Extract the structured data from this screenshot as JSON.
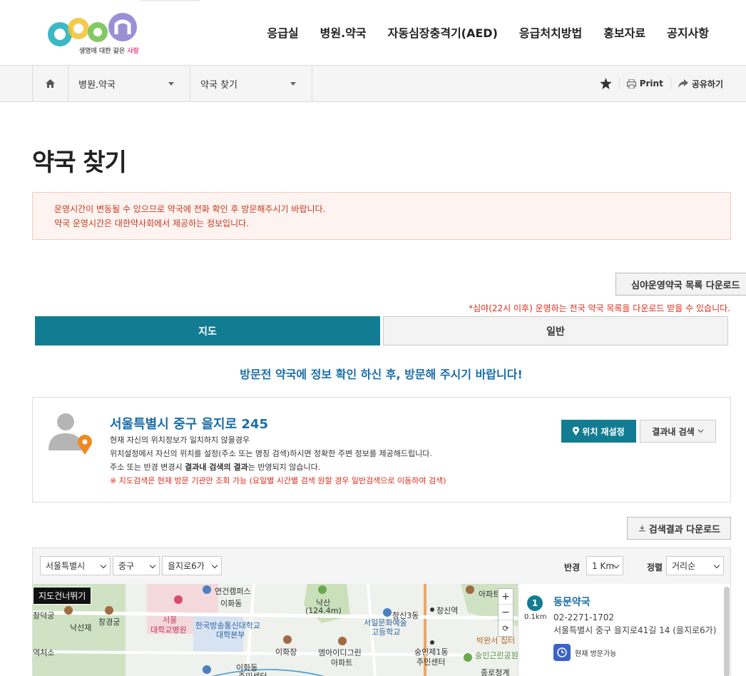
{
  "header": {
    "logo_tagline_prefix": "생명에 대한 같은",
    "logo_tagline_accent": "사랑",
    "nav": [
      "응급실",
      "병원.약국",
      "자동심장충격기(AED)",
      "응급처치방법",
      "홍보자료",
      "공지사항"
    ]
  },
  "breadcrumb": {
    "level1": "병원.약국",
    "level2": "약국 찾기",
    "print_label": "Print",
    "share_label": "공유하기"
  },
  "page": {
    "title": "약국 찾기",
    "notice_line1": "운영시간이 변동될 수 있으므로 약국에 전화 확인 후 방문해주시기 바랍니다.",
    "notice_line2": "약국 운영시간은 대한약사회에서 제공하는 정보입니다.",
    "night_download_label": "심야운영약국 목록 다운로드",
    "night_download_note": "*심야(22시 이후) 운영하는 전국 약국 목록을 다운로드 받을 수 있습니다.",
    "guide": "방문전 약국에 정보 확인 하신 후, 방문해 주시기 바랍니다!"
  },
  "tabs": {
    "map": "지도",
    "general": "일반"
  },
  "location": {
    "address": "서울특별시 중구 을지로 245",
    "line1": "현재 자신의 위치정보가 일치하지 않을경우",
    "line2": "위치설정에서 자신의 위치를 설정(주소 또는 명칭 검색)하시면 정확한 주변 정보를 제공해드립니다.",
    "line3_pre": "주소 또는 반경 변경시 ",
    "line3_bold": "결과내 검색의 결과",
    "line3_post": "는 반영되지 않습니다.",
    "line4": "※ 지도검색은 현재 방문 기관만 조회 가능 (요일별 시간별 검색 원할 경우 일반검색으로 이동하여 검색)",
    "reset_label": "위치 재설정",
    "inner_search_label": "결과내 검색"
  },
  "results_download_label": "검색결과 다운로드",
  "filters": {
    "sido": "서울특별시",
    "sigungu": "중구",
    "dong": "을지로6가",
    "radius_label": "반경",
    "radius": "1 Km",
    "sort_label": "정렬",
    "sort": "거리순"
  },
  "map": {
    "skip_label": "지도건너뛰기",
    "labels": [
      "연건캠퍼스",
      "이화동",
      "낙산",
      "(124.4m)",
      "창신역",
      "창덕궁",
      "창경궁",
      "낙선재",
      "서울",
      "대학교병원",
      "한국방송통신대학교",
      "대학본부",
      "이화장",
      "엠아이디그린",
      "아파트",
      "서일문화예술",
      "고등학교",
      "숭인제1동",
      "주민센터",
      "역처소",
      "이화동",
      "주민센터",
      "창신3동",
      "아파트",
      "박완서 집터",
      "숭인근린공원",
      "종로청계"
    ],
    "zoom_in": "+",
    "zoom_out": "−",
    "refresh": "⟳"
  },
  "result": {
    "number": "1",
    "distance": "0.1km",
    "name": "동문약국",
    "tel": "02-2271-1702",
    "address": "서울특별시 중구 을지로41길 14 (을지로6가)",
    "status": "현재 방문가능"
  },
  "colors": {
    "teal": "#127c93",
    "link_blue": "#1a6ea8",
    "warn_red": "#e02b1a"
  }
}
